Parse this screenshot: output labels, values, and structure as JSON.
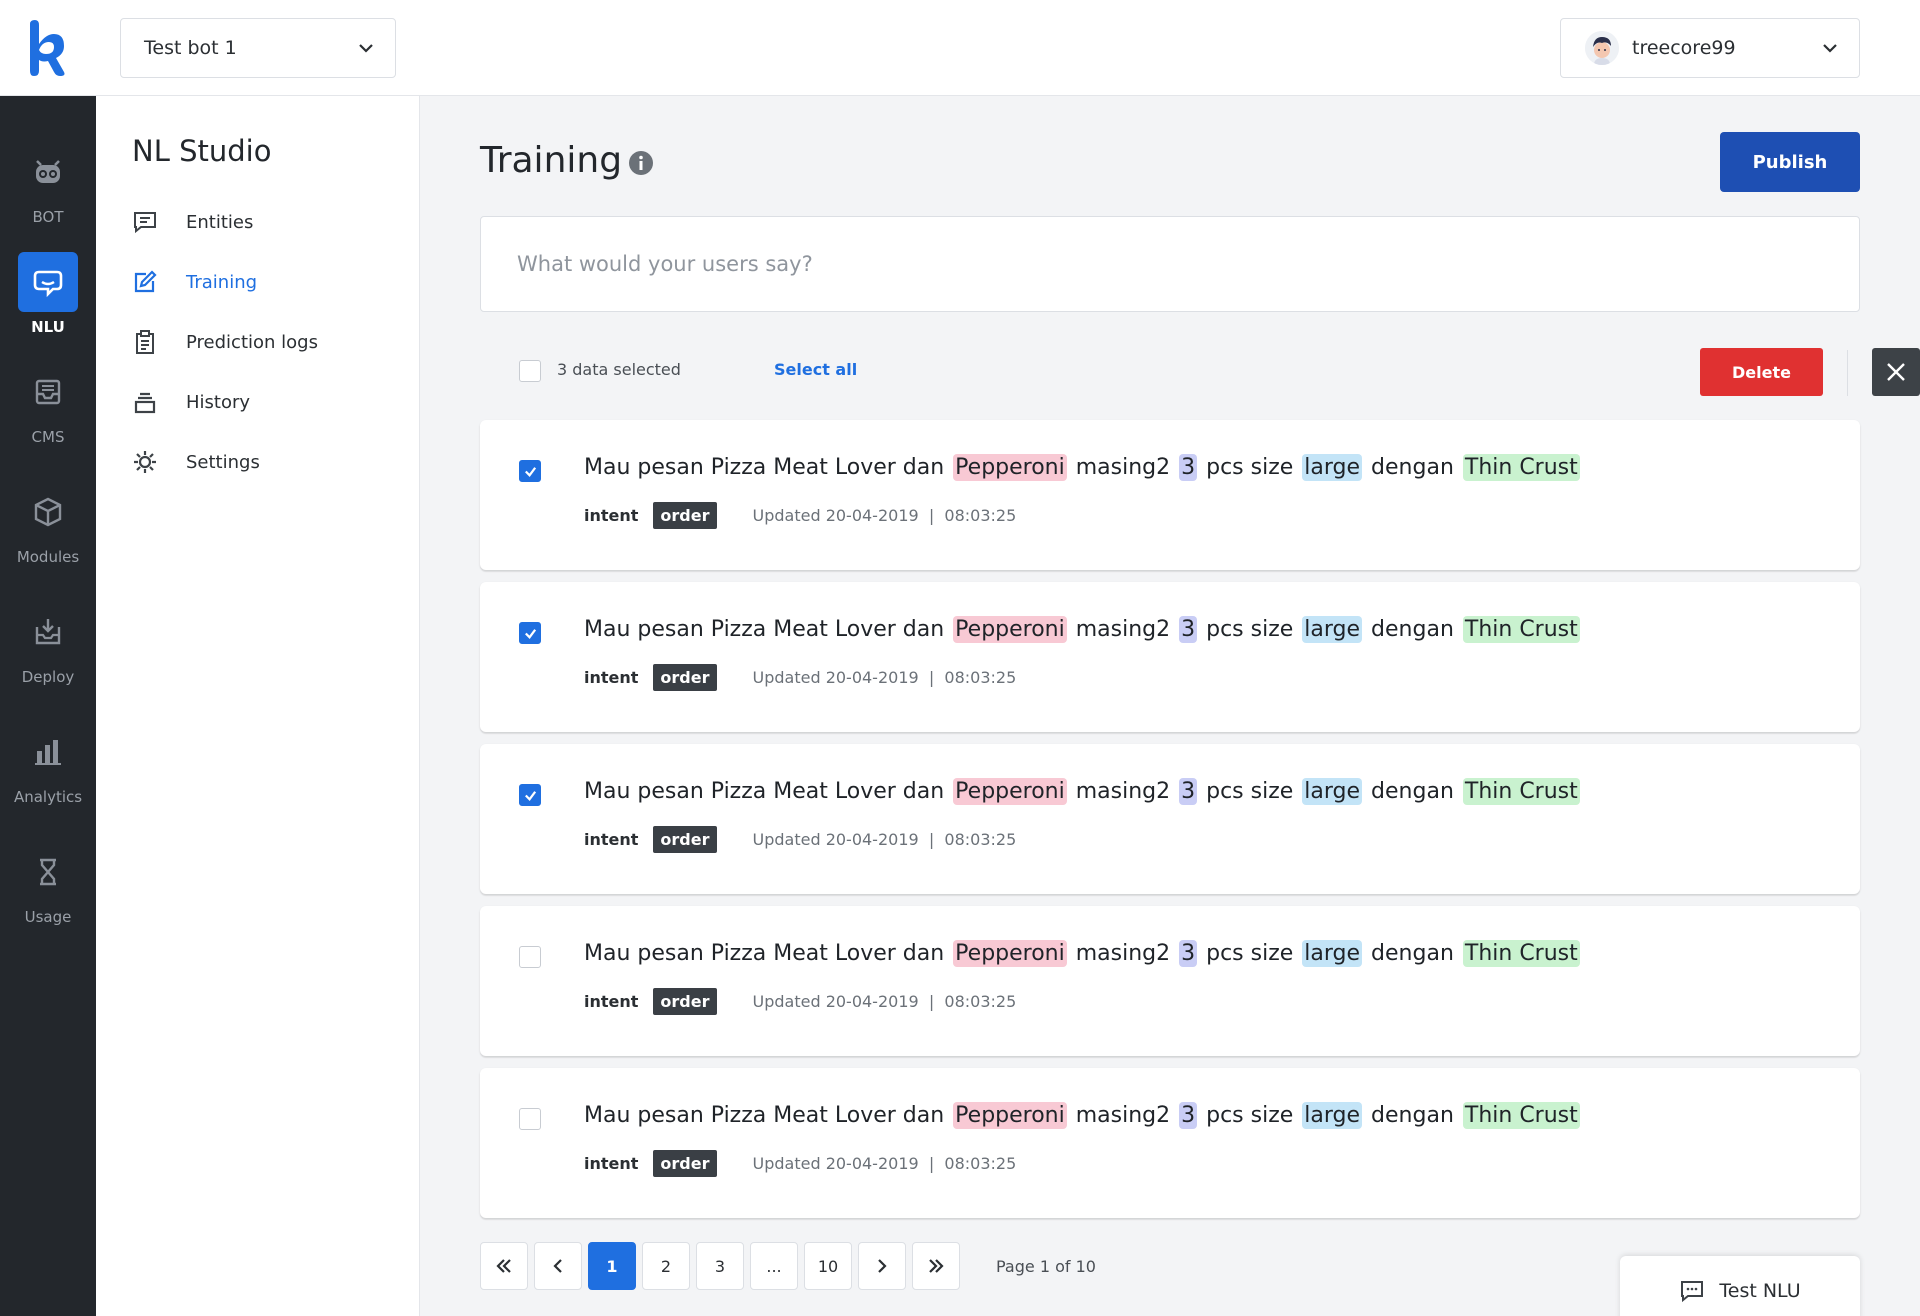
{
  "colors": {
    "accent": "#1f6fe0",
    "publish": "#1e4fb3",
    "danger": "#e03131",
    "rail_bg": "#23272c",
    "entity_pink": "#f8c9d4",
    "entity_purple": "#c9cdf5",
    "entity_blue": "#c3e4f7",
    "entity_green": "#c9f2cf"
  },
  "topbar": {
    "bot_name": "Test bot 1",
    "user_name": "treecore99"
  },
  "rail": {
    "items": [
      {
        "label": "BOT",
        "icon": "robot-icon"
      },
      {
        "label": "NLU",
        "icon": "chat-bubble-icon",
        "active": true
      },
      {
        "label": "CMS",
        "icon": "inbox-icon"
      },
      {
        "label": "Modules",
        "icon": "cube-icon"
      },
      {
        "label": "Deploy",
        "icon": "deploy-icon"
      },
      {
        "label": "Analytics",
        "icon": "bar-chart-icon"
      },
      {
        "label": "Usage",
        "icon": "hourglass-icon"
      }
    ]
  },
  "subnav": {
    "title": "NL Studio",
    "items": [
      {
        "label": "Entities",
        "icon": "message-square-icon"
      },
      {
        "label": "Training",
        "icon": "edit-icon",
        "active": true
      },
      {
        "label": "Prediction logs",
        "icon": "clipboard-icon"
      },
      {
        "label": "History",
        "icon": "layers-icon"
      },
      {
        "label": "Settings",
        "icon": "gear-icon"
      }
    ]
  },
  "main": {
    "title": "Training",
    "publish_label": "Publish",
    "input_placeholder": "What would your users say?",
    "toolbar": {
      "selected_text": "3 data selected",
      "select_all_label": "Select all",
      "delete_label": "Delete"
    },
    "rows": [
      {
        "checked": true,
        "segments": [
          {
            "text": "Mau pesan Pizza Meat Lover dan ",
            "entity": null
          },
          {
            "text": "Pepperoni",
            "entity": "pink"
          },
          {
            "text": " masing2 ",
            "entity": null
          },
          {
            "text": "3",
            "entity": "purple"
          },
          {
            "text": " pcs size ",
            "entity": null
          },
          {
            "text": "large",
            "entity": "blue"
          },
          {
            "text": " dengan ",
            "entity": null
          },
          {
            "text": "Thin Crust",
            "entity": "green"
          }
        ],
        "intent_label": "intent",
        "intent": "order",
        "updated": "Updated 20-04-2019  |  08:03:25"
      },
      {
        "checked": true,
        "segments": [
          {
            "text": "Mau pesan Pizza Meat Lover dan ",
            "entity": null
          },
          {
            "text": "Pepperoni",
            "entity": "pink"
          },
          {
            "text": " masing2 ",
            "entity": null
          },
          {
            "text": "3",
            "entity": "purple"
          },
          {
            "text": " pcs size ",
            "entity": null
          },
          {
            "text": "large",
            "entity": "blue"
          },
          {
            "text": " dengan ",
            "entity": null
          },
          {
            "text": "Thin Crust",
            "entity": "green"
          }
        ],
        "intent_label": "intent",
        "intent": "order",
        "updated": "Updated 20-04-2019  |  08:03:25"
      },
      {
        "checked": true,
        "segments": [
          {
            "text": "Mau pesan Pizza Meat Lover dan ",
            "entity": null
          },
          {
            "text": "Pepperoni",
            "entity": "pink"
          },
          {
            "text": " masing2 ",
            "entity": null
          },
          {
            "text": "3",
            "entity": "purple"
          },
          {
            "text": " pcs size ",
            "entity": null
          },
          {
            "text": "large",
            "entity": "blue"
          },
          {
            "text": " dengan ",
            "entity": null
          },
          {
            "text": "Thin Crust",
            "entity": "green"
          }
        ],
        "intent_label": "intent",
        "intent": "order",
        "updated": "Updated 20-04-2019  |  08:03:25"
      },
      {
        "checked": false,
        "segments": [
          {
            "text": "Mau pesan Pizza Meat Lover dan ",
            "entity": null
          },
          {
            "text": "Pepperoni",
            "entity": "pink"
          },
          {
            "text": " masing2 ",
            "entity": null
          },
          {
            "text": "3",
            "entity": "purple"
          },
          {
            "text": " pcs size ",
            "entity": null
          },
          {
            "text": "large",
            "entity": "blue"
          },
          {
            "text": " dengan ",
            "entity": null
          },
          {
            "text": "Thin Crust",
            "entity": "green"
          }
        ],
        "intent_label": "intent",
        "intent": "order",
        "updated": "Updated 20-04-2019  |  08:03:25"
      },
      {
        "checked": false,
        "segments": [
          {
            "text": "Mau pesan Pizza Meat Lover dan ",
            "entity": null
          },
          {
            "text": "Pepperoni",
            "entity": "pink"
          },
          {
            "text": " masing2 ",
            "entity": null
          },
          {
            "text": "3",
            "entity": "purple"
          },
          {
            "text": " pcs size ",
            "entity": null
          },
          {
            "text": "large",
            "entity": "blue"
          },
          {
            "text": " dengan ",
            "entity": null
          },
          {
            "text": "Thin Crust",
            "entity": "green"
          }
        ],
        "intent_label": "intent",
        "intent": "order",
        "updated": "Updated 20-04-2019  |  08:03:25"
      }
    ],
    "pagination": {
      "pages": [
        "1",
        "2",
        "3",
        "...",
        "10"
      ],
      "current": "1",
      "info": "Page 1 of 10"
    },
    "test_nlu_label": "Test NLU"
  }
}
